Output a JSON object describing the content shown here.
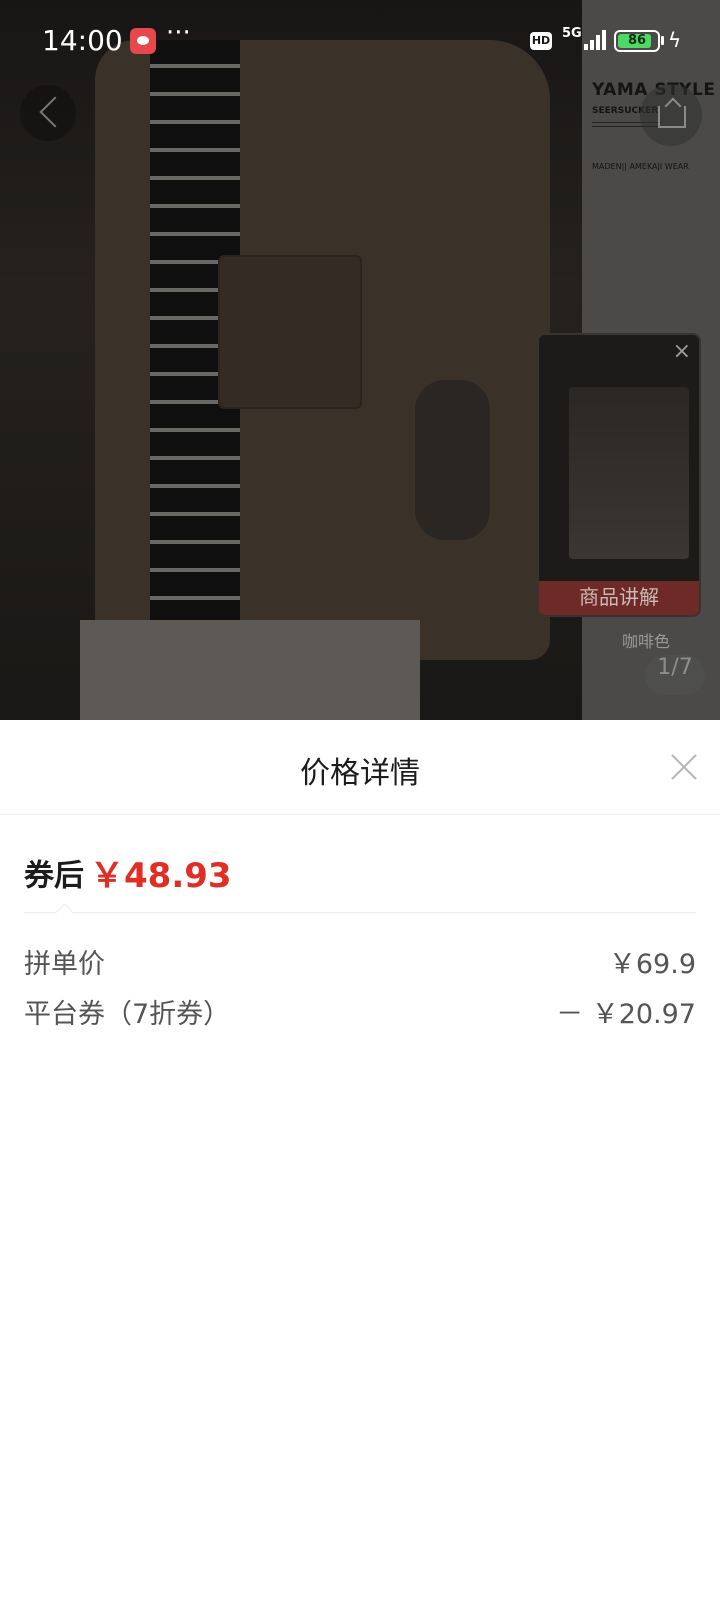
{
  "status_bar": {
    "time": "14:00",
    "dots": "···",
    "network_hd": "HD",
    "network_type": "5G",
    "battery_level": "86",
    "battery_fraction": 0.86
  },
  "product_view": {
    "poster_title": "YAMA STYLE",
    "poster_subtitle": "SEERSUCKER",
    "poster_caption": "MADEN|| AMEKAJI WEAR",
    "video_card_label": "商品讲解",
    "color_label": "咖啡色",
    "page_indicator": "1/7"
  },
  "price_sheet": {
    "title": "价格详情",
    "final_label": "券后",
    "final_price": "￥48.93",
    "rows": [
      {
        "label": "拼单价",
        "value": "￥69.9"
      },
      {
        "label": "平台券（7折券）",
        "value": "－ ￥20.97"
      }
    ]
  },
  "colors": {
    "accent_red": "#e02e24",
    "battery_green": "#4cd964",
    "text_dark": "#1c1c1c",
    "text_gray": "#555555"
  }
}
